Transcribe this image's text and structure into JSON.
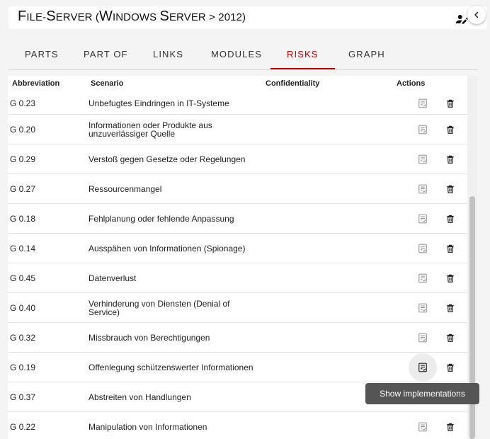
{
  "header": {
    "title_parts": [
      {
        "cap": "F",
        "low": "ile-"
      },
      {
        "cap": "S",
        "low": "erver ("
      },
      {
        "cap": "W",
        "low": "indows "
      },
      {
        "cap": "S",
        "low": "erver > 2012)"
      }
    ],
    "edit_icon": "user-edit-icon",
    "collapse_icon": "chevron-left-icon"
  },
  "tabs": [
    {
      "label": "PARTS"
    },
    {
      "label": "PART OF"
    },
    {
      "label": "LINKS"
    },
    {
      "label": "MODULES"
    },
    {
      "label": "RISKS"
    },
    {
      "label": "GRAPH"
    }
  ],
  "active_tab": "RISKS",
  "table": {
    "headers": {
      "abbreviation": "Abbreviation",
      "scenario": "Scenario",
      "confidentiality": "Confidentiality",
      "actions": "Actions"
    },
    "rows": [
      {
        "abbr": "G 0.23",
        "scenario": "Unbefugtes Eindringen in IT-Systeme"
      },
      {
        "abbr": "G 0.20",
        "scenario": "Informationen oder Produkte aus unzuverlässiger Quelle"
      },
      {
        "abbr": "G 0.29",
        "scenario": "Verstoß gegen Gesetze oder Regelungen"
      },
      {
        "abbr": "G 0.27",
        "scenario": "Ressourcenmangel"
      },
      {
        "abbr": "G 0.18",
        "scenario": "Fehlplanung oder fehlende Anpassung"
      },
      {
        "abbr": "G 0.14",
        "scenario": "Ausspähen von Informationen (Spionage)"
      },
      {
        "abbr": "G 0.45",
        "scenario": "Datenverlust"
      },
      {
        "abbr": "G 0.40",
        "scenario": "Verhinderung von Diensten (Denial of Service)"
      },
      {
        "abbr": "G 0.32",
        "scenario": "Missbrauch von Berechtigungen"
      },
      {
        "abbr": "G 0.19",
        "scenario": "Offenlegung schützenswerter Informationen"
      },
      {
        "abbr": "G 0.37",
        "scenario": "Abstreiten von Handlungen"
      },
      {
        "abbr": "G 0.22",
        "scenario": "Manipulation von Informationen"
      }
    ],
    "action_icons": {
      "implementations": "list-check-icon",
      "delete": "trash-icon"
    }
  },
  "tooltip": {
    "text": "Show implementations"
  }
}
